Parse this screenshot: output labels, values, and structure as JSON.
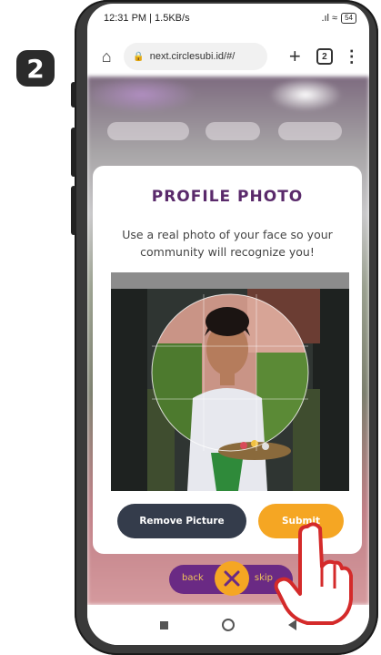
{
  "step_badge": "2",
  "statusbar": {
    "time_speed": "12:31 PM | 1.5KB/s",
    "signal_wifi": ".ıl ≈",
    "battery": "54"
  },
  "browser": {
    "url": "next.circlesubi.id/#/",
    "tab_count": "2",
    "home_icon": "home-icon",
    "new_tab_icon": "plus-icon",
    "menu_icon": "more-vert-icon"
  },
  "modal": {
    "title": "PROFILE PHOTO",
    "description": "Use a real photo of your face so your community will recognize you!",
    "remove_label": "Remove Picture",
    "submit_label": "Submit"
  },
  "bottom_nav": {
    "back_label": "back",
    "skip_label": "skip"
  },
  "colors": {
    "title": "#5a2a6b",
    "remove_button": "#343c4b",
    "submit_button": "#f5a623",
    "pill": "#6a2a84"
  }
}
